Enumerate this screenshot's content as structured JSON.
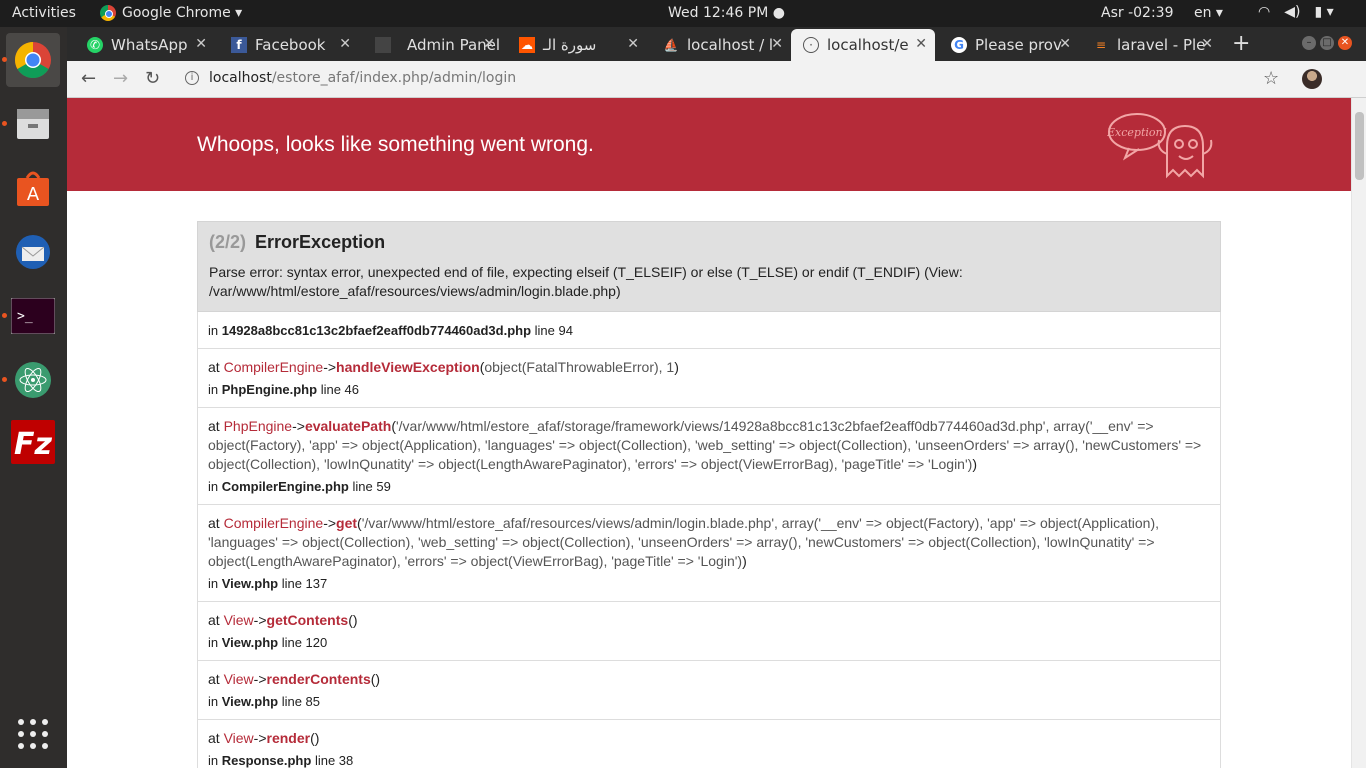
{
  "topbar": {
    "activities": "Activities",
    "app_name": "Google Chrome ▾",
    "clock": "Wed 12:46 PM ●",
    "prayer": "Asr -02:39",
    "lang": "en ▾"
  },
  "tabs": [
    {
      "title": "WhatsApp",
      "icon": "whatsapp-icon"
    },
    {
      "title": "Facebook",
      "icon": "facebook-icon"
    },
    {
      "title": "Admin Panel",
      "icon": "admin-icon"
    },
    {
      "title": "سورة الـ",
      "icon": "soundcloud-icon"
    },
    {
      "title": "localhost / l",
      "icon": "phpmyadmin-icon"
    },
    {
      "title": "localhost/e",
      "icon": "globe-icon"
    },
    {
      "title": "Please prov",
      "icon": "google-icon"
    },
    {
      "title": "laravel - Ple",
      "icon": "stackoverflow-icon"
    }
  ],
  "address": {
    "host": "localhost",
    "path": "/estore_afaf/index.php/admin/login"
  },
  "banner": {
    "title": "Whoops, looks like something went wrong.",
    "badge": "Exception!"
  },
  "exception": {
    "count": "(2/2)",
    "type": "ErrorException",
    "message": "Parse error: syntax error, unexpected end of file, expecting elseif (T_ELSEIF) or else (T_ELSE) or endif (T_ENDIF) (View: /var/www/html/estore_afaf/resources/views/admin/login.blade.php)"
  },
  "trace": [
    {
      "at": "",
      "cls": "",
      "fn": "",
      "args": "",
      "file": "14928a8bcc81c13c2bfaef2eaff0db774460ad3d.php",
      "line": "line 94"
    },
    {
      "at": "at ",
      "cls": "CompilerEngine",
      "fn": "handleViewException",
      "args": "object(FatalThrowableError), 1",
      "file": "PhpEngine.php",
      "line": "line 46"
    },
    {
      "at": "at ",
      "cls": "PhpEngine",
      "fn": "evaluatePath",
      "args": "'/var/www/html/estore_afaf/storage/framework/views/14928a8bcc81c13c2bfaef2eaff0db774460ad3d.php', array('__env' => object(Factory), 'app' => object(Application), 'languages' => object(Collection), 'web_setting' => object(Collection), 'unseenOrders' => array(), 'newCustomers' => object(Collection), 'lowInQunatity' => object(LengthAwarePaginator), 'errors' => object(ViewErrorBag), 'pageTitle' => 'Login')",
      "file": "CompilerEngine.php",
      "line": "line 59"
    },
    {
      "at": "at ",
      "cls": "CompilerEngine",
      "fn": "get",
      "args": "'/var/www/html/estore_afaf/resources/views/admin/login.blade.php', array('__env' => object(Factory), 'app' => object(Application), 'languages' => object(Collection), 'web_setting' => object(Collection), 'unseenOrders' => array(), 'newCustomers' => object(Collection), 'lowInQunatity' => object(LengthAwarePaginator), 'errors' => object(ViewErrorBag), 'pageTitle' => 'Login')",
      "file": "View.php",
      "line": "line 137"
    },
    {
      "at": "at ",
      "cls": "View",
      "fn": "getContents",
      "args": "",
      "file": "View.php",
      "line": "line 120"
    },
    {
      "at": "at ",
      "cls": "View",
      "fn": "renderContents",
      "args": "",
      "file": "View.php",
      "line": "line 85"
    },
    {
      "at": "at ",
      "cls": "View",
      "fn": "render",
      "args": "",
      "file": "Response.php",
      "line": "line 38"
    }
  ],
  "colors": {
    "banner": "#b52b39",
    "accent": "#e95420"
  }
}
